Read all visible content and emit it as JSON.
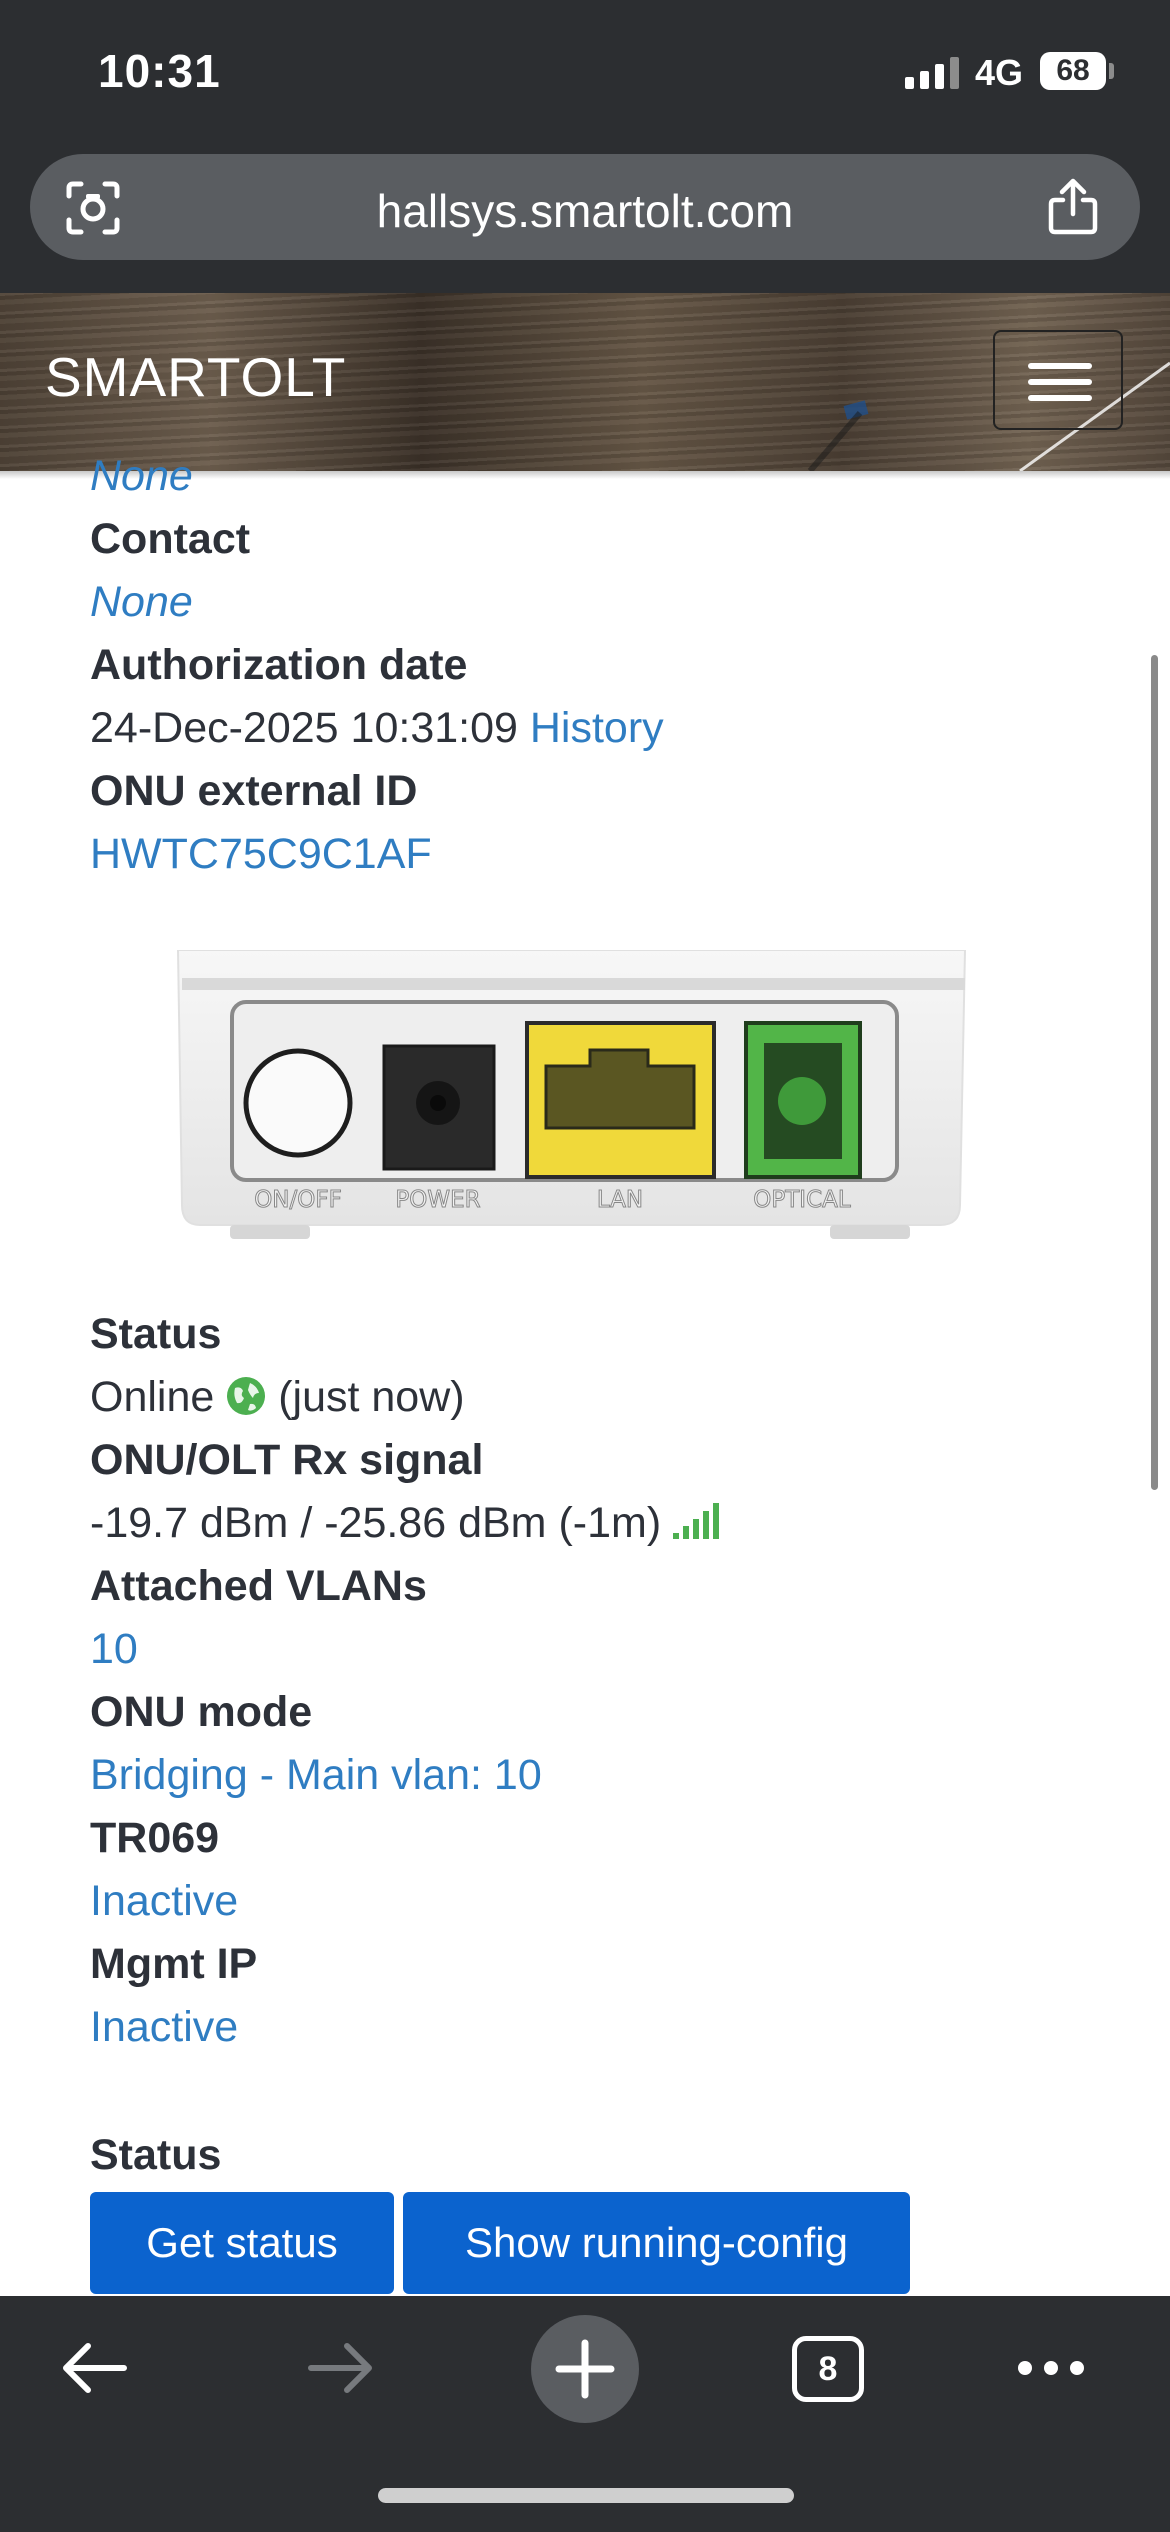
{
  "status_bar": {
    "time": "10:31",
    "network": "4G",
    "battery": "68"
  },
  "browser": {
    "url": "hallsys.smartolt.com",
    "open_tabs": "8"
  },
  "header": {
    "brand": "SMARTOLT"
  },
  "details": {
    "cut_value": "None",
    "contact_label": "Contact",
    "contact_value": "None",
    "auth_label": "Authorization date",
    "auth_value": "24-Dec-2025 10:31:09",
    "auth_history_link": "History",
    "ext_id_label": "ONU external ID",
    "ext_id_value": "HWTC75C9C1AF"
  },
  "device_ports": [
    "ON/OFF",
    "POWER",
    "LAN",
    "OPTICAL"
  ],
  "status_info": {
    "status_label": "Status",
    "status_value": "Online",
    "status_time": "(just now)",
    "rx_label": "ONU/OLT Rx signal",
    "rx_value": "-19.7 dBm / -25.86 dBm (-1m)",
    "vlans_label": "Attached VLANs",
    "vlans_value": "10",
    "mode_label": "ONU mode",
    "mode_value": "Bridging - Main vlan: 10",
    "tr069_label": "TR069",
    "tr069_value": "Inactive",
    "mgmt_label": "Mgmt IP",
    "mgmt_value": "Inactive"
  },
  "actions": {
    "section_label": "Status",
    "get_status": "Get status",
    "show_config": "Show running-config"
  },
  "colors": {
    "link": "#2f7dc2",
    "button": "#0b63ce",
    "online": "#4caf50",
    "chrome": "#2c2e31"
  },
  "icons": [
    "lens-icon",
    "share-icon",
    "menu-icon",
    "globe-icon",
    "signal-bars-icon",
    "back-icon",
    "forward-icon",
    "plus-icon",
    "tabs-icon",
    "more-icon"
  ]
}
